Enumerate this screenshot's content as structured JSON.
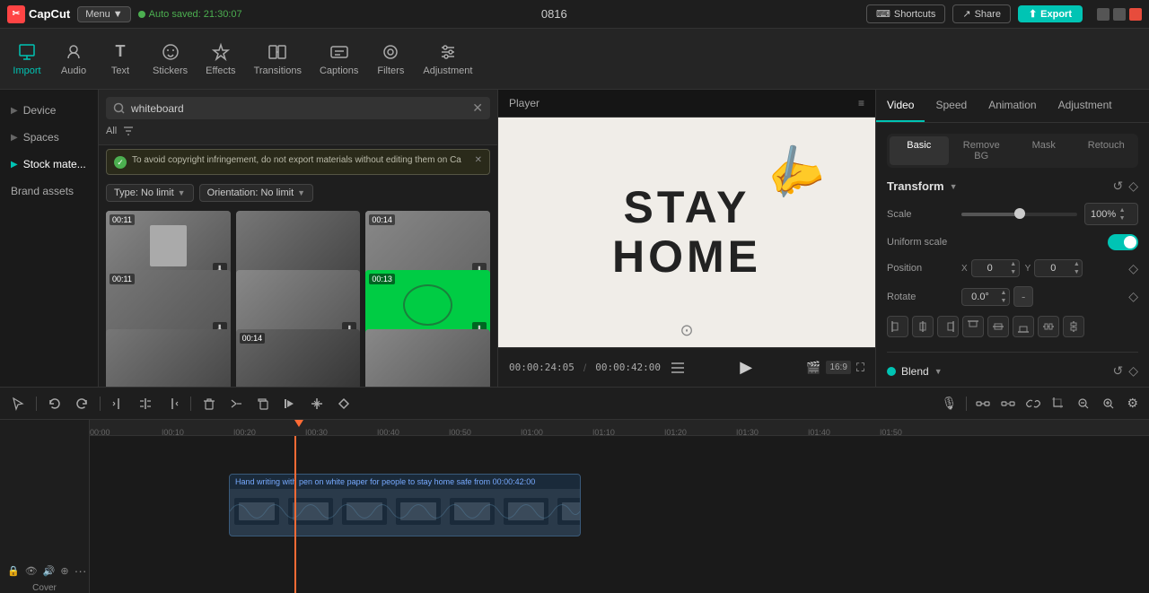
{
  "app": {
    "logo": "CapCut",
    "menu_label": "Menu",
    "menu_dropdown": "▼",
    "auto_save": "Auto saved: 21:30:07",
    "project_id": "0816"
  },
  "top_right": {
    "shortcuts_label": "Shortcuts",
    "share_label": "Share",
    "export_label": "Export"
  },
  "toolbar": {
    "items": [
      {
        "id": "import",
        "label": "Import",
        "icon": "⬇"
      },
      {
        "id": "audio",
        "label": "Audio",
        "icon": "♪"
      },
      {
        "id": "text",
        "label": "Text",
        "icon": "T"
      },
      {
        "id": "stickers",
        "label": "Stickers",
        "icon": "⊙"
      },
      {
        "id": "effects",
        "label": "Effects",
        "icon": "✦"
      },
      {
        "id": "transitions",
        "label": "Transitions",
        "icon": "⧉"
      },
      {
        "id": "captions",
        "label": "Captions",
        "icon": "≡"
      },
      {
        "id": "filters",
        "label": "Filters",
        "icon": "⬡"
      },
      {
        "id": "adjustment",
        "label": "Adjustment",
        "icon": "⇌"
      }
    ],
    "active": "import"
  },
  "left_panel": {
    "nav_items": [
      {
        "id": "device",
        "label": "Device",
        "arrow": "▶"
      },
      {
        "id": "spaces",
        "label": "Spaces",
        "arrow": "▶"
      },
      {
        "id": "stock_materials",
        "label": "Stock mate...",
        "arrow": "▶",
        "active": true
      },
      {
        "id": "brand_assets",
        "label": "Brand assets"
      }
    ],
    "search": {
      "placeholder": "whiteboard",
      "value": "whiteboard",
      "clear_icon": "✕",
      "all_label": "All",
      "filter_icon": "≡"
    },
    "warning": {
      "icon": "✓",
      "text": "To avoid copyright infringement, do not export materials without editing them on Ca",
      "close_icon": "✕"
    },
    "filters": [
      {
        "id": "type",
        "label": "Type: No limit",
        "chevron": "▼"
      },
      {
        "id": "orientation",
        "label": "Orientation: No limit",
        "chevron": "▼"
      }
    ],
    "videos": [
      {
        "id": 1,
        "duration": "00:11",
        "has_download": true,
        "class": "thumb-1"
      },
      {
        "id": 2,
        "duration": "",
        "has_download": false,
        "class": "thumb-2"
      },
      {
        "id": 3,
        "duration": "00:14",
        "has_download": true,
        "class": "thumb-3"
      },
      {
        "id": 4,
        "duration": "00:11",
        "has_download": true,
        "class": "thumb-4"
      },
      {
        "id": 5,
        "duration": "",
        "has_download": true,
        "class": "thumb-5"
      },
      {
        "id": 6,
        "duration": "00:13",
        "has_download": true,
        "class": "thumb-6"
      },
      {
        "id": 7,
        "duration": "",
        "has_download": false,
        "class": "thumb-7"
      },
      {
        "id": 8,
        "duration": "00:14",
        "has_download": false,
        "class": "thumb-8"
      },
      {
        "id": 9,
        "duration": "",
        "has_download": false,
        "class": "thumb-9"
      }
    ]
  },
  "player": {
    "title": "Player",
    "menu_icon": "≡",
    "video_text_line1": "STAY",
    "video_text_line2": "HOME",
    "current_time": "00:00:24:05",
    "total_time": "00:00:42:00",
    "pip_icon": "⊙",
    "play_icon": "▶",
    "pip_btn": "🎥",
    "ratio_btn": "16:9",
    "fullscreen_btn": "⛶"
  },
  "right_panel": {
    "tabs": [
      {
        "id": "video",
        "label": "Video",
        "active": true
      },
      {
        "id": "speed",
        "label": "Speed"
      },
      {
        "id": "animation",
        "label": "Animation"
      },
      {
        "id": "adjustment",
        "label": "Adjustment"
      }
    ],
    "sub_tabs": [
      {
        "id": "basic",
        "label": "Basic",
        "active": true
      },
      {
        "id": "remove_bg",
        "label": "Remove BG"
      },
      {
        "id": "mask",
        "label": "Mask"
      },
      {
        "id": "retouch",
        "label": "Retouch"
      }
    ],
    "transform": {
      "title": "Transform",
      "arrow": "▼",
      "reset_icon": "↺",
      "diamond_icon": "◇",
      "scale": {
        "label": "Scale",
        "value": "100%",
        "percent": 50
      },
      "uniform_scale": {
        "label": "Uniform scale",
        "enabled": true
      },
      "position": {
        "label": "Position",
        "x_label": "X",
        "x_value": "0",
        "y_label": "Y",
        "y_value": "0"
      },
      "rotate": {
        "label": "Rotate",
        "value": "0.0°",
        "dash": "-"
      },
      "align_buttons": [
        "⊢",
        "+",
        "⊣",
        "⊤",
        "⊕",
        "⊥",
        "⊧",
        "⊨"
      ]
    },
    "blend": {
      "title": "Blend",
      "dot_color": "#00c4b4",
      "arrow": "▼",
      "reset_icon": "↺",
      "diamond_icon": "◇"
    }
  },
  "timeline": {
    "toolbar_buttons": [
      {
        "id": "select",
        "icon": "↖",
        "tooltip": "Select"
      },
      {
        "id": "undo",
        "icon": "↩",
        "tooltip": "Undo"
      },
      {
        "id": "redo",
        "icon": "↪",
        "tooltip": "Redo"
      },
      {
        "id": "split_left",
        "icon": "⊢",
        "tooltip": "Split left"
      },
      {
        "id": "split",
        "icon": "⊣",
        "tooltip": "Split"
      },
      {
        "id": "split_right",
        "icon": "⊤",
        "tooltip": "Split right"
      },
      {
        "id": "delete",
        "icon": "🗑",
        "tooltip": "Delete"
      },
      {
        "id": "cut_left",
        "icon": "✂",
        "tooltip": "Cut left"
      },
      {
        "id": "copy",
        "icon": "❐",
        "tooltip": "Copy"
      },
      {
        "id": "play_clip",
        "icon": "▶",
        "tooltip": "Play clip"
      },
      {
        "id": "freeze",
        "icon": "❄",
        "tooltip": "Freeze"
      },
      {
        "id": "keyframe",
        "icon": "◇",
        "tooltip": "Keyframe"
      }
    ],
    "right_buttons": [
      {
        "id": "mic",
        "icon": "🎙",
        "tooltip": "Record"
      },
      {
        "id": "connect",
        "icon": "⊞",
        "tooltip": "Connect"
      },
      {
        "id": "unlink",
        "icon": "⊟",
        "tooltip": "Unlink"
      },
      {
        "id": "link",
        "icon": "⊠",
        "tooltip": "Link"
      },
      {
        "id": "crop",
        "icon": "⊡",
        "tooltip": "Crop"
      },
      {
        "id": "zoom_in",
        "icon": "⊕",
        "tooltip": "Zoom in"
      },
      {
        "id": "zoom_out",
        "icon": "⊖",
        "tooltip": "Zoom out"
      },
      {
        "id": "more",
        "icon": "⊗",
        "tooltip": "More"
      },
      {
        "id": "settings",
        "icon": "⊘",
        "tooltip": "Settings"
      }
    ],
    "ruler_marks": [
      "00:00",
      "00:10",
      "00:20",
      "00:30",
      "00:40",
      "00:50",
      "01:00",
      "01:10",
      "01:20",
      "01:30",
      "01:40",
      "01:50"
    ],
    "clip": {
      "label": "Hand writing with pen on white paper for people to stay home safe from  00:00:42:00",
      "color": "#2a3a4a"
    },
    "track_icons": [
      "🔒",
      "👁",
      "🔊",
      "⊕"
    ],
    "cover_label": "Cover"
  }
}
